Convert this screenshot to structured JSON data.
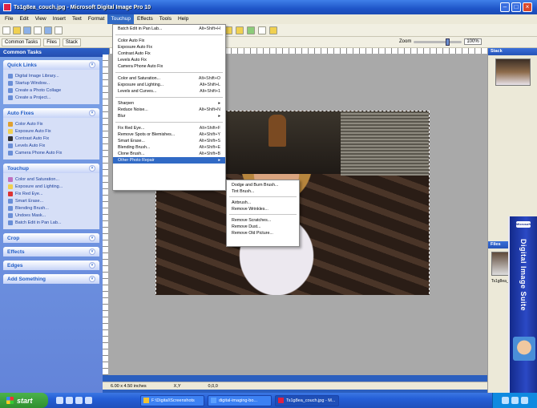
{
  "window": {
    "title": "Ts1g8ea_couch.jpg - Microsoft Digital Image Pro 10"
  },
  "menubar": {
    "items": [
      "File",
      "Edit",
      "View",
      "Insert",
      "Text",
      "Format",
      "Touchup",
      "Effects",
      "Tools",
      "Help"
    ]
  },
  "toolbar2": {
    "buttons": [
      "Common Tasks",
      "Files",
      "Stack"
    ],
    "zoom_label": "Zoom",
    "zoom_value": "100%"
  },
  "taskpane": {
    "header": "Common Tasks",
    "groups": [
      {
        "title": "Quick Links",
        "items": [
          "Digital Image Library...",
          "Startup Window...",
          "Create a Photo Collage",
          "Create a Project..."
        ]
      },
      {
        "title": "Auto Fixes",
        "items": [
          "Color Auto Fix",
          "Exposure Auto Fix",
          "Contrast Auto Fix",
          "Levels Auto Fix",
          "Camera Phone Auto Fix"
        ]
      },
      {
        "title": "Touchup",
        "items": [
          "Color and Saturation...",
          "Exposure and Lighting...",
          "Fix Red Eye...",
          "Smart Erase...",
          "Blending Brush...",
          "Undoes Mask...",
          "Batch Edit in Pan Lab..."
        ]
      },
      {
        "title": "Crop"
      },
      {
        "title": "Effects"
      },
      {
        "title": "Edges"
      },
      {
        "title": "Add Something"
      }
    ]
  },
  "dropdown": {
    "items": [
      {
        "label": "Batch Edit in Pan Lab...",
        "shortcut": "Alt+Shift+H"
      },
      {
        "sep": true
      },
      {
        "label": "Color Auto Fix",
        "shortcut": ""
      },
      {
        "label": "Exposure Auto Fix",
        "shortcut": ""
      },
      {
        "label": "Contrast Auto Fix",
        "shortcut": ""
      },
      {
        "label": "Levels Auto Fix",
        "shortcut": ""
      },
      {
        "label": "Camera Phone Auto Fix",
        "shortcut": ""
      },
      {
        "sep": true
      },
      {
        "label": "Color and Saturation...",
        "shortcut": "Alt+Shift+O"
      },
      {
        "label": "Exposure and Lighting...",
        "shortcut": "Alt+Shift+L"
      },
      {
        "label": "Levels and Curves...",
        "shortcut": "Alt+Shift+1"
      },
      {
        "sep": true
      },
      {
        "label": "Sharpen",
        "shortcut": "▸"
      },
      {
        "label": "Reduce Noise...",
        "shortcut": "Alt+Shift+N"
      },
      {
        "label": "Blur",
        "shortcut": "▸"
      },
      {
        "sep": true
      },
      {
        "label": "Fix Red Eye...",
        "shortcut": "Alt+Shift+F"
      },
      {
        "label": "Remove Spots or Blemishes...",
        "shortcut": "Alt+Shift+Y"
      },
      {
        "label": "Smart Erase...",
        "shortcut": "Alt+Shift+S"
      },
      {
        "label": "Blending Brush...",
        "shortcut": "Alt+Shift+E"
      },
      {
        "label": "Clone Brush...",
        "shortcut": "Alt+Shift+B"
      },
      {
        "label": "Other Photo Repair",
        "shortcut": "▸",
        "highlight": true
      }
    ]
  },
  "submenu": {
    "items": [
      {
        "label": "Dodge and Burn Brush..."
      },
      {
        "label": "Tint Brush..."
      },
      {
        "sep": true
      },
      {
        "label": "Airbrush..."
      },
      {
        "label": "Remove Wrinkles..."
      },
      {
        "sep": true
      },
      {
        "label": "Remove Scratches..."
      },
      {
        "label": "Remove Dust..."
      },
      {
        "label": "Remove Old Picture..."
      }
    ]
  },
  "rightpanel": {
    "stack_title": "Stack",
    "layers_title": "Files",
    "layer_name": "Ts1g8ea_couch..."
  },
  "statusbar": {
    "size": "6.00 x 4.50 inches",
    "pos1": "X,Y",
    "pos2": "0,0,0"
  },
  "softbox": {
    "brand": "Microsoft",
    "title": "Digital Image Suite"
  },
  "taskbar": {
    "start": "start",
    "tasks": [
      "F:\\Digital\\Screenshots",
      "digital-imaging-bo...",
      "Ts1g8ea_couch.jpg - M..."
    ]
  }
}
